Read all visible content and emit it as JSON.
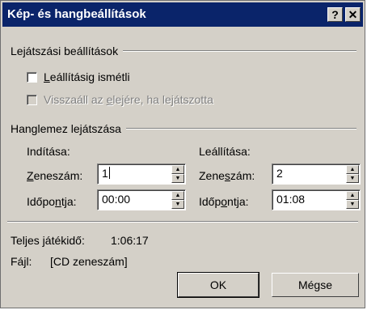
{
  "window": {
    "title": "Kép- és hangbeállítások"
  },
  "titlebar": {
    "help_label": "?",
    "close_label": "✕"
  },
  "playback": {
    "group_label": "Lejátszási beállítások",
    "loop": {
      "label_pre": "",
      "label_ul": "L",
      "label_post": "eállításig ismétli",
      "checked": false
    },
    "rewind": {
      "label_pre": "Visszaáll az ",
      "label_ul": "e",
      "label_post": "lejére, ha lejátszotta",
      "checked": false,
      "disabled": true
    }
  },
  "cd": {
    "group_label": "Hanglemez lejátszása",
    "start": {
      "heading": "Indítása:",
      "track_label_ul": "Z",
      "track_label_post": "eneszám:",
      "track_value": "1",
      "time_label_pre": "Időpo",
      "time_label_ul": "n",
      "time_label_post": "tja:",
      "time_value": "00:00"
    },
    "end": {
      "heading": "Leállítása:",
      "track_label_pre": "Zene",
      "track_label_ul": "s",
      "track_label_post": "zám:",
      "track_value": "2",
      "time_label_pre": "Időp",
      "time_label_ul": "o",
      "time_label_post": "ntja:",
      "time_value": "01:08"
    }
  },
  "info": {
    "total_label": "Teljes játékidő:",
    "total_value": "1:06:17",
    "file_label": "Fájl:",
    "file_value": "[CD zeneszám]"
  },
  "buttons": {
    "ok": "OK",
    "cancel": "Mégse"
  },
  "colors": {
    "titlebar": "#0a246a",
    "face": "#d4d0c8"
  }
}
